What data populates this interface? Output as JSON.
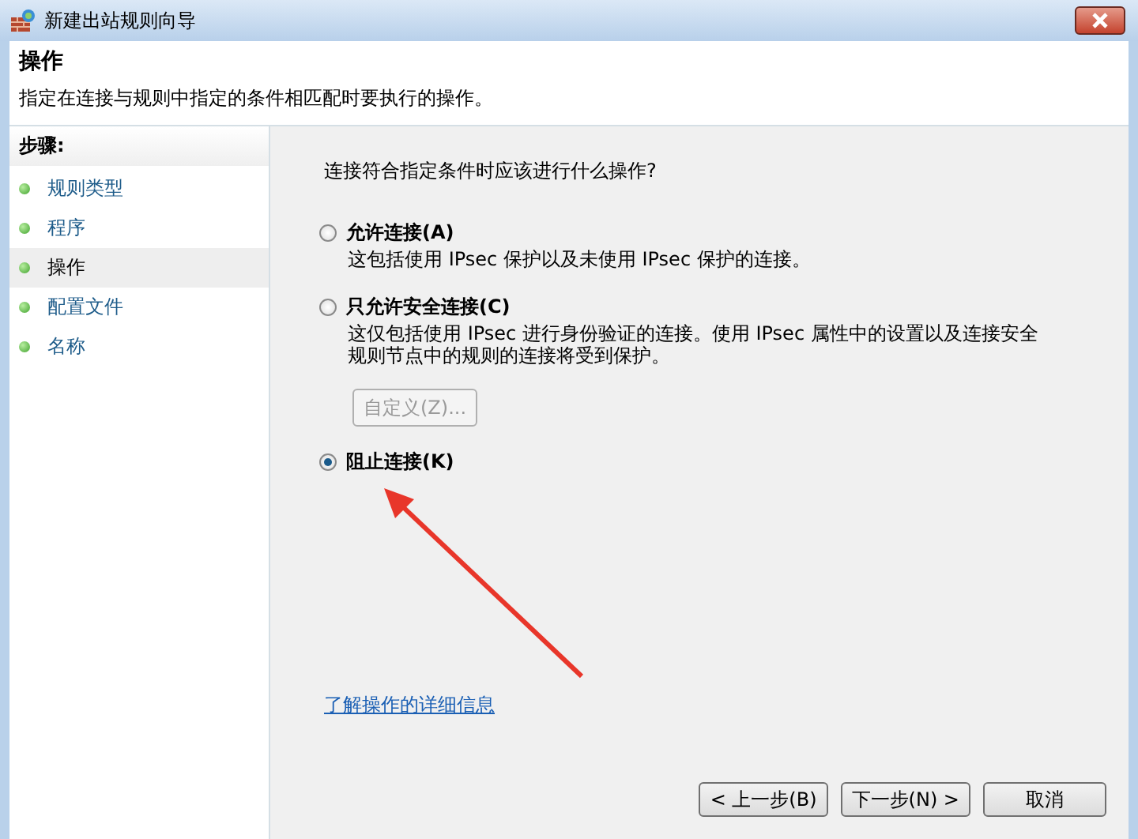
{
  "window": {
    "title": "新建出站规则向导"
  },
  "header": {
    "title": "操作",
    "subtitle": "指定在连接与规则中指定的条件相匹配时要执行的操作。"
  },
  "steps": {
    "heading": "步骤:",
    "items": [
      {
        "label": "规则类型",
        "selected": false
      },
      {
        "label": "程序",
        "selected": false
      },
      {
        "label": "操作",
        "selected": true
      },
      {
        "label": "配置文件",
        "selected": false
      },
      {
        "label": "名称",
        "selected": false
      }
    ]
  },
  "question": "连接符合指定条件时应该进行什么操作?",
  "options": [
    {
      "label": "允许连接(A)",
      "description": "这包括使用 IPsec 保护以及未使用 IPsec 保护的连接。",
      "selected": false
    },
    {
      "label": "只允许安全连接(C)",
      "description": "这仅包括使用 IPsec 进行身份验证的连接。使用 IPsec 属性中的设置以及连接安全规则节点中的规则的连接将受到保护。",
      "selected": false,
      "button": {
        "label": "自定义(Z)...",
        "disabled": true
      }
    },
    {
      "label": "阻止连接(K)",
      "selected": true
    }
  ],
  "help_link": "了解操作的详细信息",
  "buttons": [
    {
      "label": "< 上一步(B)",
      "disabled": false
    },
    {
      "label": "下一步(N) >",
      "disabled": false
    },
    {
      "label": "取消",
      "disabled": false
    }
  ]
}
